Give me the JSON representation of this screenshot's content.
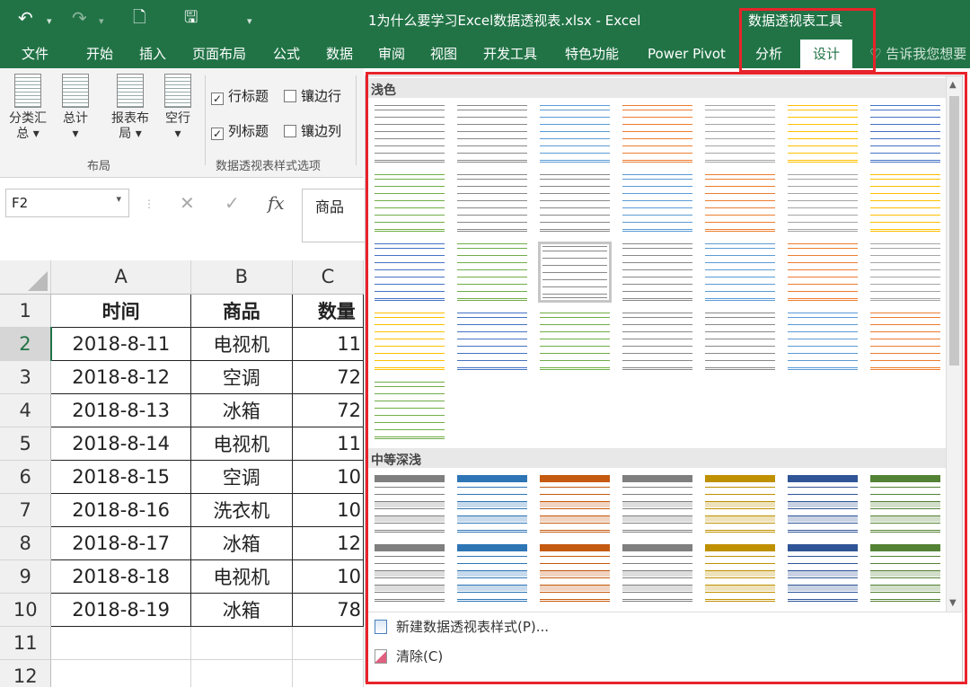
{
  "titlebar": {
    "doc_title": "1为什么要学习Excel数据透视表.xlsx - Excel",
    "context_group": "数据透视表工具"
  },
  "menu": [
    "文件",
    "开始",
    "插入",
    "页面布局",
    "公式",
    "数据",
    "审阅",
    "视图",
    "开发工具",
    "特色功能",
    "Power Pivot",
    "分析",
    "设计"
  ],
  "menu_active": "设计",
  "tell_me": "告诉我您想要",
  "ribbon": {
    "buttons": [
      {
        "label": "分类汇\n总 ▾"
      },
      {
        "label": "总计\n▾"
      },
      {
        "label": "报表布\n局 ▾"
      },
      {
        "label": "空行\n▾"
      }
    ],
    "layout_group": "布局",
    "options": [
      {
        "label": "行标题",
        "checked": true
      },
      {
        "label": "镶边行",
        "checked": false
      },
      {
        "label": "列标题",
        "checked": true
      },
      {
        "label": "镶边列",
        "checked": false
      }
    ],
    "options_group": "数据透视表样式选项"
  },
  "formula_bar": {
    "name_box": "F2",
    "cancel": "✕",
    "enter": "✓",
    "fx": "fx",
    "content": "商品"
  },
  "sheet": {
    "columns": [
      "A",
      "B",
      "C"
    ],
    "rows": [
      "1",
      "2",
      "3",
      "4",
      "5",
      "6",
      "7",
      "8",
      "9",
      "10",
      "11",
      "12"
    ],
    "header": [
      "时间",
      "商品",
      "数量"
    ],
    "data": [
      [
        "2018-8-11",
        "电视机",
        "11"
      ],
      [
        "2018-8-12",
        "空调",
        "72"
      ],
      [
        "2018-8-13",
        "冰箱",
        "72"
      ],
      [
        "2018-8-14",
        "电视机",
        "11"
      ],
      [
        "2018-8-15",
        "空调",
        "10"
      ],
      [
        "2018-8-16",
        "洗衣机",
        "10"
      ],
      [
        "2018-8-17",
        "冰箱",
        "12"
      ],
      [
        "2018-8-18",
        "电视机",
        "10"
      ],
      [
        "2018-8-19",
        "冰箱",
        "78"
      ]
    ]
  },
  "gallery": {
    "light_label": "浅色",
    "medium_label": "中等深浅",
    "light_colors": [
      "#888888",
      "#888888",
      "#5b9bd5",
      "#ed7d31",
      "#a5a5a5",
      "#ffc000",
      "#4472c4",
      "#70ad47"
    ],
    "medium_colors": [
      "#7f7f7f",
      "#2e75b6",
      "#c55a11",
      "#7f7f7f",
      "#bf9000",
      "#2f5597",
      "#548235"
    ],
    "footer_new": "新建数据透视表样式(P)...",
    "footer_clear": "清除(C)"
  }
}
